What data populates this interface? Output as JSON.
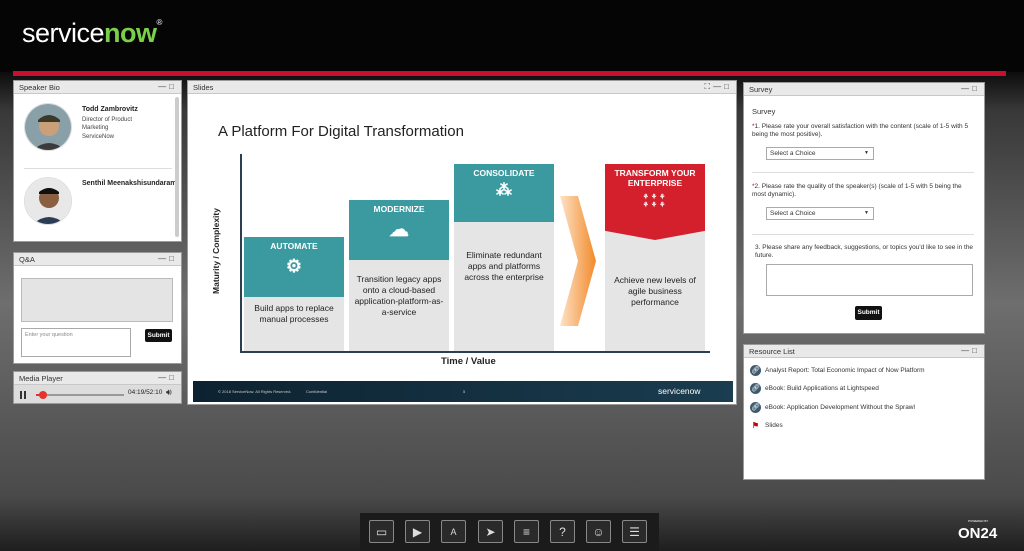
{
  "header": {
    "logo_service": "service",
    "logo_now": "now",
    "logo_tm": "®"
  },
  "speaker_bio": {
    "title": "Speaker Bio",
    "speakers": [
      {
        "name": "Todd Zambrovitz",
        "title": "Director of Product Marketing",
        "company": "ServiceNow"
      },
      {
        "name": "Senthil Meenakshisundaram"
      }
    ]
  },
  "qa": {
    "title": "Q&A",
    "placeholder": "Enter your question",
    "submit": "Submit"
  },
  "media": {
    "title": "Media Player",
    "time": "04:19/52:10",
    "progress": 0.083
  },
  "slides": {
    "title": "Slides",
    "slide_title": "A Platform For Digital Transformation",
    "ylabel": "Maturity / Complexity",
    "xlabel": "Time / Value",
    "columns": [
      {
        "head": "AUTOMATE",
        "text": "Build apps to replace manual processes"
      },
      {
        "head": "MODERNIZE",
        "text": "Transition legacy apps onto a cloud-based application-platform-as-a-service"
      },
      {
        "head": "CONSOLIDATE",
        "text": "Eliminate redundant apps and platforms across the enterprise"
      },
      {
        "head": "TRANSFORM YOUR ENTERPRISE",
        "text": "Achieve new levels of agile business performance"
      }
    ],
    "footer_copy": "© 2018 ServiceNow. All Rights Reserved.",
    "footer_conf": "Confidential",
    "footer_page": "5",
    "footer_logo": "servicenow"
  },
  "survey": {
    "title": "Survey",
    "heading": "Survey",
    "q1_num": "1.",
    "q1": "Please rate your overall satisfaction with the content (scale of 1-5 with 5 being the most positive).",
    "q2_num": "2.",
    "q2": "Please rate the quality of the speaker(s) (scale of 1-5 with 5 being the most dynamic).",
    "q3_num": "3.",
    "q3": "Please share any feedback, suggestions, or topics you'd like to see in the future.",
    "select": "Select a Choice",
    "required": "*",
    "submit": "Submit"
  },
  "resources": {
    "title": "Resource List",
    "items": [
      {
        "label": "Analyst Report: Total Economic Impact of Now Platform",
        "type": "link"
      },
      {
        "label": "eBook: Build Applications at Lightspeed",
        "type": "link"
      },
      {
        "label": "eBook: Application Development Without the Sprawl",
        "type": "link"
      },
      {
        "label": "Slides",
        "type": "pdf"
      }
    ]
  },
  "toolbar": {
    "icons": [
      "monitor-icon",
      "video-icon",
      "translate-icon",
      "send-icon",
      "document-icon",
      "help-icon",
      "person-icon",
      "clipboard-icon"
    ]
  },
  "branding": {
    "on24": "ON24",
    "powered": "POWERED BY"
  },
  "colors": {
    "teal": "#3b9aa0",
    "red": "#d4202d",
    "brand_green": "#7ad04a",
    "accent_red": "#c8102e"
  }
}
